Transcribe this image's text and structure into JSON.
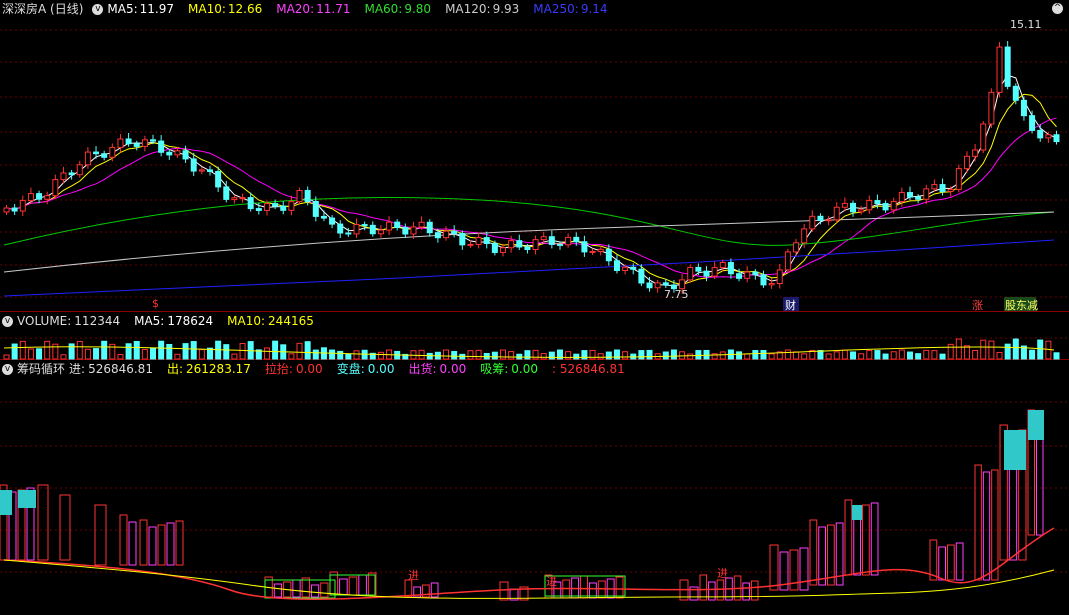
{
  "price_panel": {
    "title": "深深房A (日线)",
    "collapse_icon": "chevron-down-icon",
    "ma5_label": "MA5:",
    "ma5_value": "11.97",
    "ma10_label": "MA10:",
    "ma10_value": "12.66",
    "ma20_label": "MA20:",
    "ma20_value": "11.71",
    "ma60_label": "MA60:",
    "ma60_value": "9.80",
    "ma120_label": "MA120:",
    "ma120_value": "9.93",
    "ma250_label": "MA250:",
    "ma250_value": "9.14",
    "high_marker": "15.11",
    "low_marker": "7.75",
    "event_marker_dollar": "$",
    "event_marker_cai": "财",
    "event_marker_zhang": "涨",
    "event_marker_jianchi": "股东减",
    "colors": {
      "ma5": "#ffffff",
      "ma10": "#ffff00",
      "ma20": "#ff00ff",
      "ma60": "#00cc00",
      "ma120": "#c8c8c8",
      "ma250": "#2020ff",
      "up": "#ff3232",
      "down": "#54ffff"
    }
  },
  "volume_panel": {
    "title": "VOLUME:",
    "value": "112344",
    "ma5_label": "MA5:",
    "ma5_value": "178624",
    "ma10_label": "MA10:",
    "ma10_value": "244165"
  },
  "chip_panel": {
    "title": "筹码循环",
    "in_label": "进:",
    "in_value": "526846.81",
    "out_label": "出:",
    "out_value": "261283.17",
    "pull_label": "拉抬:",
    "pull_value": "0.00",
    "change_label": "变盘:",
    "change_value": "0.00",
    "ship_label": "出货:",
    "ship_value": "0.00",
    "absorb_label": "吸筹:",
    "absorb_value": "0.00",
    "last_value": "526846.81",
    "signal_label": "进",
    "colors": {
      "in": "#ff3232",
      "out": "#ffff00",
      "pull": "#ff3232",
      "change": "#54ffff",
      "ship": "#ff00ff",
      "absorb": "#00ff00"
    }
  }
}
